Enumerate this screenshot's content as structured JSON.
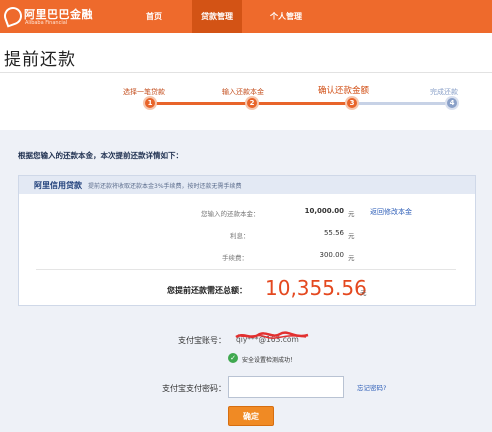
{
  "header": {
    "logo_text": "阿里巴巴金融",
    "logo_sub": "Alibaba Financial",
    "nav": [
      {
        "label": "首页",
        "active": false
      },
      {
        "label": "贷款管理",
        "active": true
      },
      {
        "label": "个人管理",
        "active": false
      }
    ]
  },
  "page_title": "提前还款",
  "steps": [
    {
      "number": "1",
      "label": "选择一笔贷款",
      "state": "done"
    },
    {
      "number": "2",
      "label": "输入还款本金",
      "state": "done"
    },
    {
      "number": "3",
      "label": "确认还款金额",
      "state": "current"
    },
    {
      "number": "4",
      "label": "完成还款",
      "state": "pending"
    }
  ],
  "intro": "根据您输入的还款本金，本次提前还款详情如下：",
  "card": {
    "title": "阿里信用贷款",
    "note": "提前还款将收取还款本金3%手续费，按时还款无需手续费",
    "rows": [
      {
        "label": "您输入的还款本金：",
        "value": "10,000.00",
        "unit": "元"
      },
      {
        "label": "利息：",
        "value": "55.56",
        "unit": "元"
      },
      {
        "label": "手续费：",
        "value": "300.00",
        "unit": "元"
      }
    ],
    "modify_link": "返回修改本金",
    "total_label": "您提前还款需还总额：",
    "total_value": "10,355.56",
    "total_unit": "元"
  },
  "form": {
    "account_label": "支付宝账号：",
    "account_value": "qiy***@163.com",
    "safety_icon": "check-circle-icon",
    "safety_text": "安全设置检测成功！",
    "password_label": "支付宝支付密码：",
    "password_value": "",
    "forgot_link": "忘记密码?",
    "confirm_label": "确定"
  },
  "colors": {
    "brand": "#ee6a2c",
    "nav_active": "#d35315",
    "step_done": "#e8642a",
    "step_pending": "#8aa0c8",
    "total": "#e4481f",
    "link": "#2f5fb8",
    "button": "#f08a24",
    "panel_bg": "#eef1f7"
  }
}
